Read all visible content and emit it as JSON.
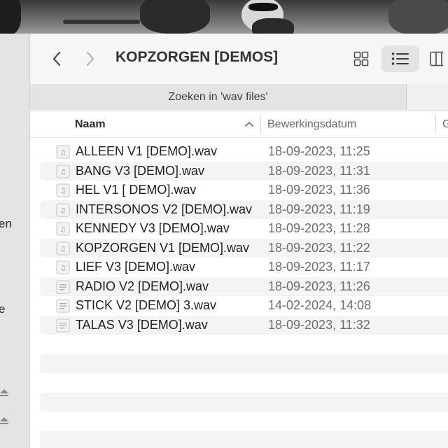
{
  "toolbar": {
    "title": "KOPZORGEN [DEMOS]",
    "back_icon": "chevron-left-icon",
    "forward_icon": "chevron-right-icon",
    "icon_view_icon": "grid-icon",
    "list_view_icon": "list-icon",
    "column_view_icon": "columns-icon"
  },
  "search": {
    "scope_label": "Zoeken in 'wav files'"
  },
  "sidebar": {
    "fragment_1": "en",
    "fragment_2": "e"
  },
  "columns": {
    "name": "Naam",
    "modified": "Bewerkingsdatum",
    "third": "G"
  },
  "files": [
    {
      "name": "ALLEEN V1 [DEMO].wav",
      "date": "18-09-2023, 11:25"
    },
    {
      "name": "BANG V3 [DEMO].wav",
      "date": "18-09-2023, 11:31"
    },
    {
      "name": "HEL V1 [ DEMO].wav",
      "date": "18-09-2023, 11:36"
    },
    {
      "name": "INTERSONOS V2 [DEMO].wav",
      "date": "18-09-2023, 11:19"
    },
    {
      "name": "KENNEDY V3 [DEMO].wav",
      "date": "18-09-2023, 11:28"
    },
    {
      "name": "KOPZORGEN V1 [DEMO].wav",
      "date": "18-09-2023, 11:22"
    },
    {
      "name": "LIEF V3 [DEMO].wav",
      "date": "18-09-2023, 11:17"
    },
    {
      "name": "RADIO V2 [DEMO].wav",
      "date": "18-09-2023, 11:26"
    },
    {
      "name": "STICK V2 [DEMO] 3.wav",
      "date": "14-02-2024, 14:08"
    },
    {
      "name": "TALAS V3 [DEMO].wav",
      "date": "18-09-2023, 11:32"
    }
  ],
  "colors": {
    "sidebar_bg": "#e4e4e4",
    "row_stripe": "#f4f4f5",
    "toolbar_bg": "#f6f6f6",
    "active_view_bg": "#e3e3e3"
  }
}
